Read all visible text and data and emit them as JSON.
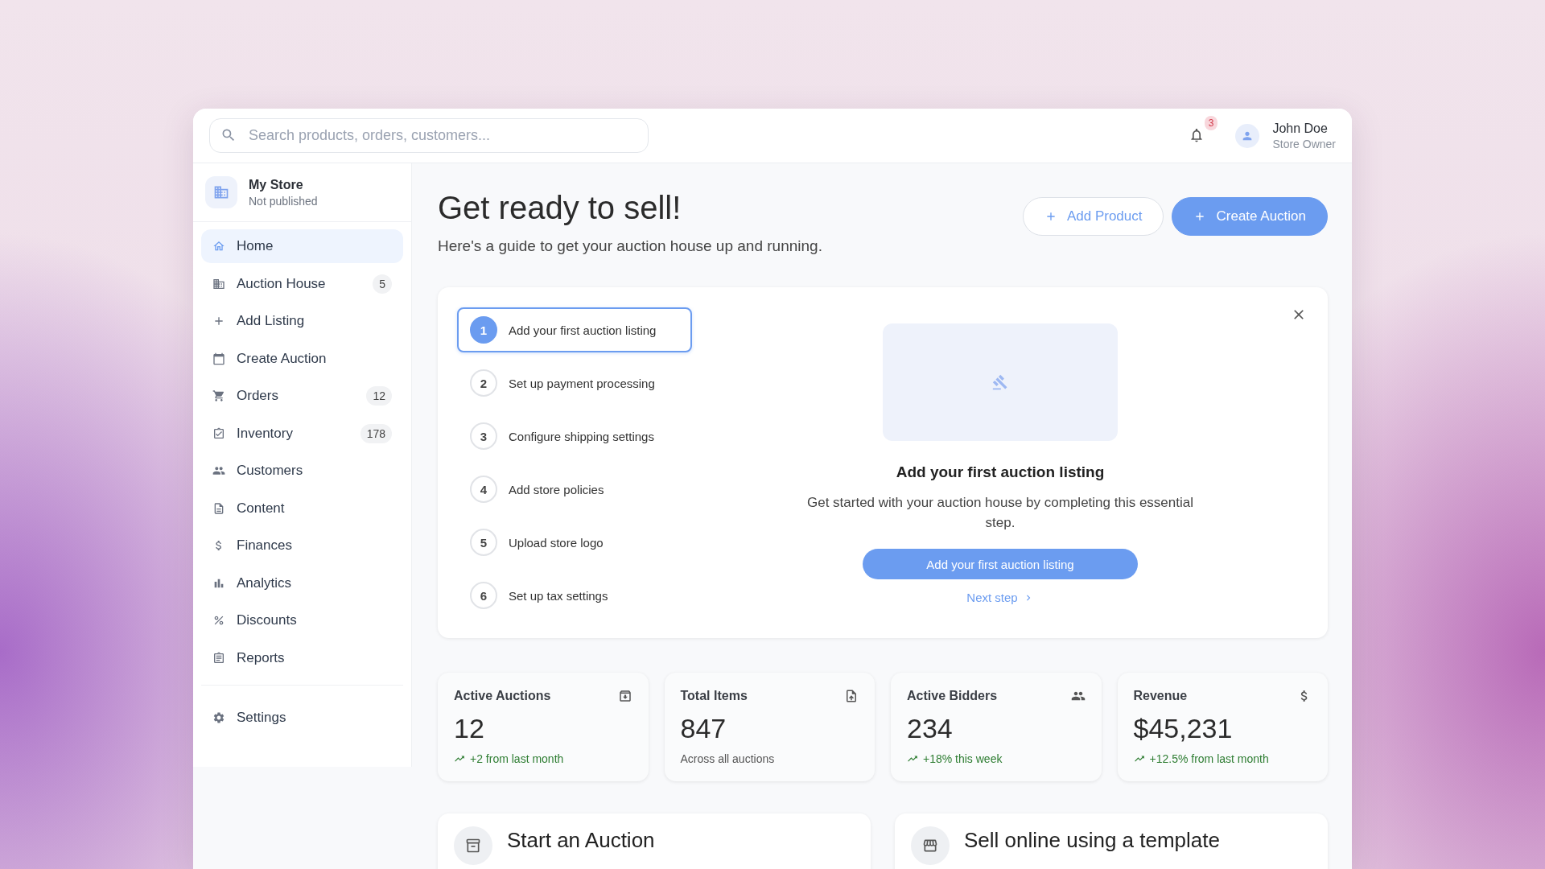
{
  "search": {
    "placeholder": "Search products, orders, customers..."
  },
  "notifications": {
    "count": "3"
  },
  "user": {
    "name": "John Doe",
    "role": "Store Owner"
  },
  "store": {
    "name": "My Store",
    "status": "Not published"
  },
  "nav": [
    {
      "label": "Home",
      "selected": true
    },
    {
      "label": "Auction House",
      "selected": false,
      "count": "5"
    },
    {
      "label": "Add Listing",
      "selected": false
    },
    {
      "label": "Create Auction",
      "selected": false
    },
    {
      "label": "Orders",
      "selected": false,
      "count": "12"
    },
    {
      "label": "Inventory",
      "selected": false,
      "count": "178"
    },
    {
      "label": "Customers",
      "selected": false
    },
    {
      "label": "Content",
      "selected": false
    },
    {
      "label": "Finances",
      "selected": false
    },
    {
      "label": "Analytics",
      "selected": false
    },
    {
      "label": "Discounts",
      "selected": false
    },
    {
      "label": "Reports",
      "selected": false
    }
  ],
  "nav_footer": {
    "label": "Settings",
    "selected": false
  },
  "header": {
    "title": "Get ready to sell!",
    "subtitle": "Here's a guide to get your auction house up and running.",
    "buttons": [
      {
        "label": "Add Product",
        "kind": "outline"
      },
      {
        "label": "Create Auction",
        "kind": "primary"
      }
    ]
  },
  "guide": {
    "steps": [
      {
        "number": "1",
        "label": "Add your first auction listing",
        "selected": true
      },
      {
        "number": "2",
        "label": "Set up payment processing",
        "selected": false
      },
      {
        "number": "3",
        "label": "Configure shipping settings",
        "selected": false
      },
      {
        "number": "4",
        "label": "Add store policies",
        "selected": false
      },
      {
        "number": "5",
        "label": "Upload store logo",
        "selected": false
      },
      {
        "number": "6",
        "label": "Set up tax settings",
        "selected": false
      }
    ],
    "detail": {
      "title": "Add your first auction listing",
      "description": "Get started with your auction house by completing this essential step.",
      "action": "Add your first auction listing",
      "next": "Next step"
    }
  },
  "stats": [
    {
      "title": "Active Auctions",
      "value": "12",
      "note": "+2 from last month",
      "trend": true
    },
    {
      "title": "Total Items",
      "value": "847",
      "note": "Across all auctions",
      "trend": false
    },
    {
      "title": "Active Bidders",
      "value": "234",
      "note": "+18% this week",
      "trend": true
    },
    {
      "title": "Revenue",
      "value": "$45,231",
      "note": "+12.5% from last month",
      "trend": true
    }
  ],
  "cards": [
    {
      "title": "Start an Auction"
    },
    {
      "title": "Sell online using a template"
    }
  ]
}
